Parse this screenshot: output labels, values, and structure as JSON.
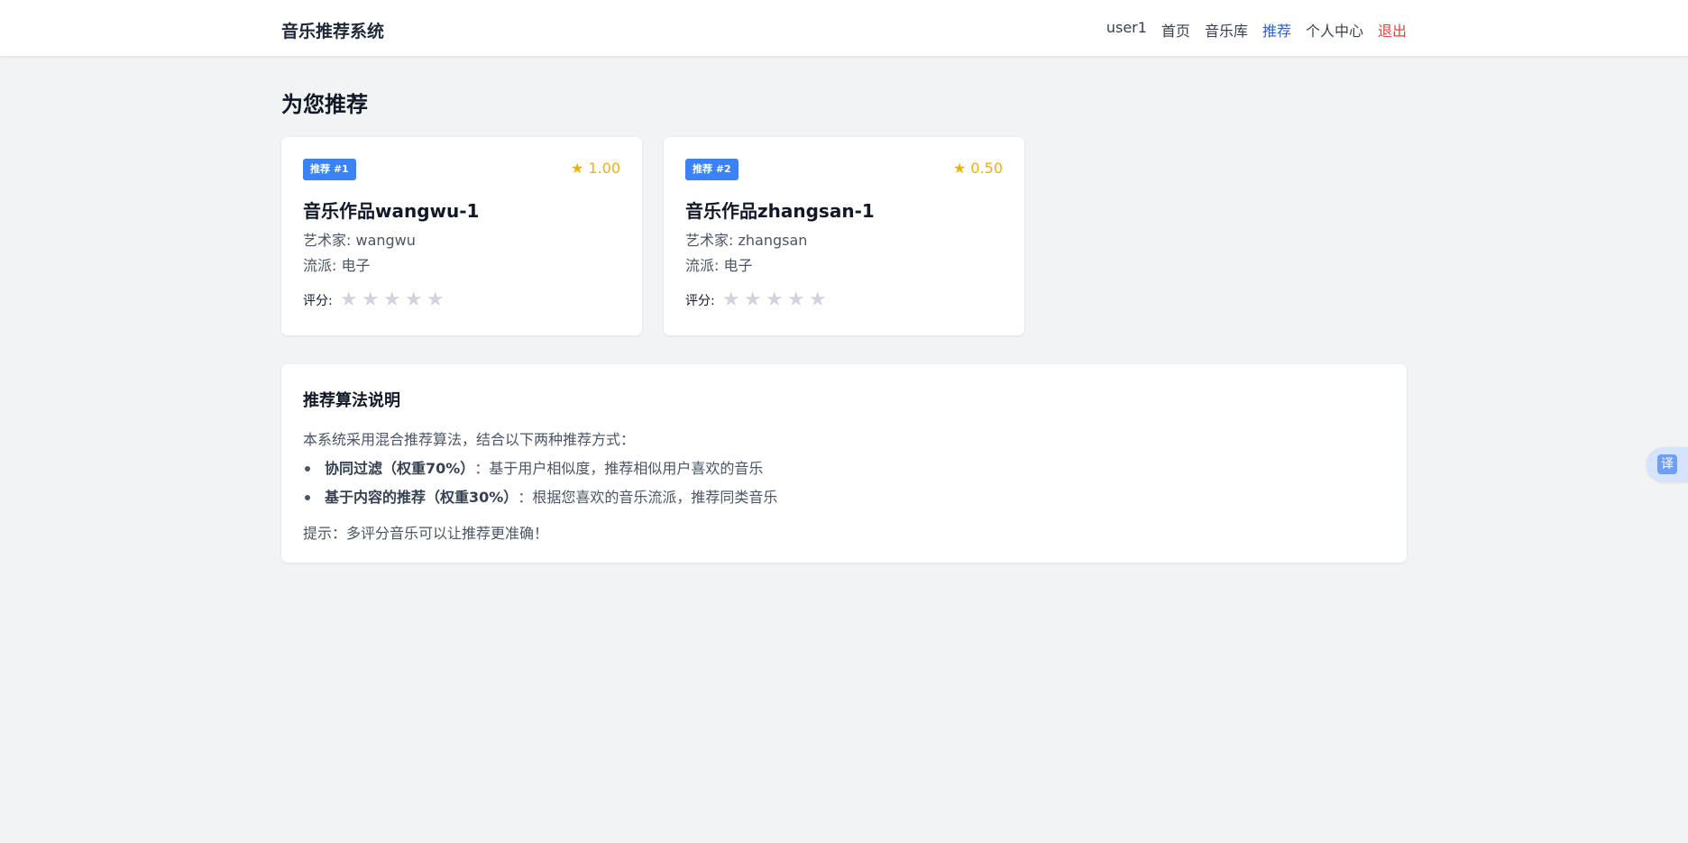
{
  "header": {
    "brand": "音乐推荐系统",
    "nav": {
      "user": "user1",
      "home": "首页",
      "library": "音乐库",
      "recommend": "推荐",
      "profile": "个人中心",
      "logout": "退出"
    }
  },
  "page_title": "为您推荐",
  "recommendations": [
    {
      "badge": "推荐 #1",
      "score": "★ 1.00",
      "title": "音乐作品wangwu-1",
      "artist": "艺术家: wangwu",
      "genre": "流派: 电子",
      "rating_label": "评分:",
      "stars": [
        "★",
        "★",
        "★",
        "★",
        "★"
      ],
      "user_rating": 0
    },
    {
      "badge": "推荐 #2",
      "score": "★ 0.50",
      "title": "音乐作品zhangsan-1",
      "artist": "艺术家: zhangsan",
      "genre": "流派: 电子",
      "rating_label": "评分:",
      "stars": [
        "★",
        "★",
        "★",
        "★",
        "★"
      ],
      "user_rating": 0
    }
  ],
  "algorithm": {
    "title": "推荐算法说明",
    "intro": "本系统采用混合推荐算法，结合以下两种推荐方式：",
    "items": [
      {
        "name": "协同过滤（权重70%）",
        "desc": "：基于用户相似度，推荐相似用户喜欢的音乐"
      },
      {
        "name": "基于内容的推荐（权重30%）",
        "desc": "：根据您喜欢的音乐流派，推荐同类音乐"
      }
    ],
    "tip": "提示：多评分音乐可以让推荐更准确！"
  },
  "translate_button": "译",
  "colors": {
    "accent": "#3b82f6",
    "active_nav": "#2563eb",
    "logout": "#e53e3e",
    "score": "#eab308",
    "star_empty": "#d1d5db",
    "background": "#f2f3f5"
  },
  "icons": {
    "score_icon": "star-icon",
    "rating_icon": "star-icon",
    "translate_icon": "translate-icon"
  }
}
